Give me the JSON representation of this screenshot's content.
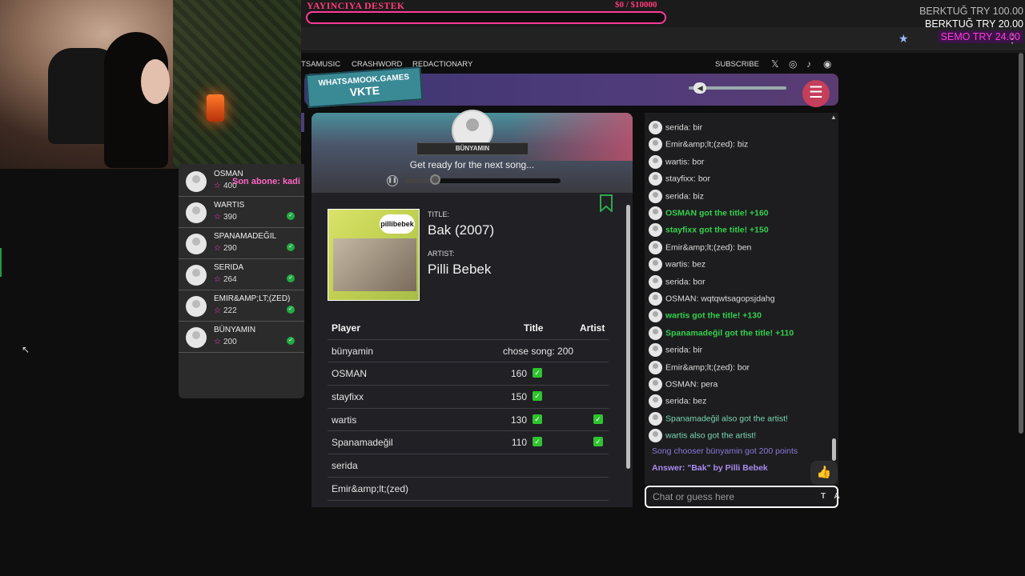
{
  "overlay": {
    "donation_title": "YAYINCIYA DESTEK",
    "donation_amount": "$0  / $10000",
    "donation_progress": 0,
    "ticker": [
      "BERKTUĞ  TRY 100.00",
      "BERKTUĞ  TRY 20.00",
      "SEMO  TRY 24.00"
    ],
    "sub_alert": "Son abone: kadi"
  },
  "nav": {
    "items": [
      "TSAMUSIC",
      "CRASHWORD",
      "REDACTIONARY"
    ],
    "subscribe": "SUBSCRIBE",
    "social": [
      "twitter-icon",
      "instagram-icon",
      "tiktok-icon",
      "discord-icon"
    ]
  },
  "header": {
    "logo_top": "WHATSAMOOK.GAMES",
    "logo_bottom": "VKTE",
    "volume_level": 0.1
  },
  "leaderboard": [
    {
      "name": "OSMAN",
      "points": "400",
      "check": false
    },
    {
      "name": "WARTIS",
      "points": "390",
      "check": true
    },
    {
      "name": "SPANAMADEĞIL",
      "points": "290",
      "check": true
    },
    {
      "name": "SERIDA",
      "points": "264",
      "check": true
    },
    {
      "name": "EMIR&AMP;LT;(ZED)",
      "points": "222",
      "check": true
    },
    {
      "name": "BÜNYAMIN",
      "points": "200",
      "check": true
    }
  ],
  "game": {
    "host_name": "BÜNYAMIN",
    "status": "Get ready for the next song...",
    "song_progress": 0.2,
    "title_label": "TITLE:",
    "title_value": "Bak (2007)",
    "artist_label": "ARTIST:",
    "artist_value": "Pilli Bebek",
    "cover_brand": "pillibebek",
    "table_headers": {
      "player": "Player",
      "title": "Title",
      "artist": "Artist"
    },
    "rows": [
      {
        "player": "bünyamin",
        "title": "chose song: 200",
        "title_check": false,
        "artist_check": false,
        "chose": true
      },
      {
        "player": "OSMAN",
        "title": "160",
        "title_check": true,
        "artist_check": false
      },
      {
        "player": "stayfixx",
        "title": "150",
        "title_check": true,
        "artist_check": false
      },
      {
        "player": "wartis",
        "title": "130",
        "title_check": true,
        "artist_check": true
      },
      {
        "player": "Spanamadeğil",
        "title": "110",
        "title_check": true,
        "artist_check": true
      },
      {
        "player": "serida",
        "title": "",
        "title_check": false,
        "artist_check": false
      },
      {
        "player": "Emir&amp;lt;(zed)",
        "title": "",
        "title_check": false,
        "artist_check": false
      }
    ]
  },
  "chat": {
    "messages": [
      {
        "text": "serida: bir",
        "kind": "msg"
      },
      {
        "text": "Emir&amp;lt;(zed): biz",
        "kind": "msg"
      },
      {
        "text": "wartis: bor",
        "kind": "msg"
      },
      {
        "text": "stayfixx: bor",
        "kind": "msg"
      },
      {
        "text": "serida: biz",
        "kind": "msg"
      },
      {
        "text": "OSMAN got the title! +160",
        "kind": "success"
      },
      {
        "text": "stayfixx got the title! +150",
        "kind": "success"
      },
      {
        "text": "Emir&amp;lt;(zed): ben",
        "kind": "msg"
      },
      {
        "text": "wartis: bez",
        "kind": "msg"
      },
      {
        "text": "serida: bor",
        "kind": "msg"
      },
      {
        "text": "OSMAN: wqtqwtsagopsjdahg",
        "kind": "msg"
      },
      {
        "text": "wartis got the title! +130",
        "kind": "success"
      },
      {
        "text": "Spanamadeğil got the title! +110",
        "kind": "success"
      },
      {
        "text": "serida: bir",
        "kind": "msg"
      },
      {
        "text": "Emir&amp;lt;(zed): bor",
        "kind": "msg"
      },
      {
        "text": "OSMAN: pera",
        "kind": "msg"
      },
      {
        "text": "serida: bez",
        "kind": "msg"
      },
      {
        "text": "Spanamadeğil also got the artist!",
        "kind": "artist"
      },
      {
        "text": "wartis also got the artist!",
        "kind": "artist"
      },
      {
        "text": "Song chooser bünyamin got 200 points",
        "kind": "sys"
      },
      {
        "text": "Answer: \"Bak\" by Pilli Bebek",
        "kind": "answer"
      }
    ],
    "input_placeholder": "Chat or guess here",
    "tools": "T A"
  }
}
